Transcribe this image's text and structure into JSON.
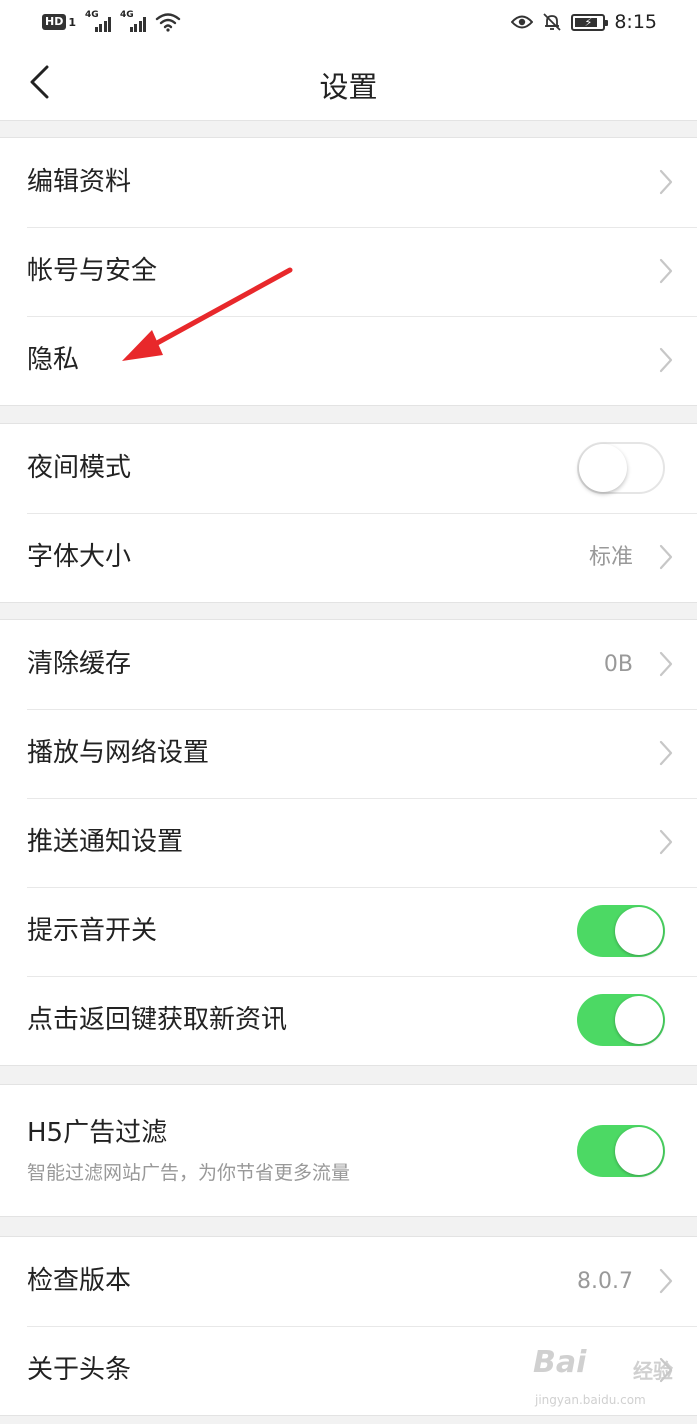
{
  "status_bar": {
    "hd_badge": "HD",
    "hd_sub": "1",
    "sim1_tag": "4G",
    "sim2_tag": "4G",
    "time": "8:15",
    "icons": [
      "signal-icon",
      "wifi-icon",
      "eye-icon",
      "mute-bell-icon",
      "battery-icon"
    ]
  },
  "nav": {
    "title": "设置",
    "back_icon": "chevron-left-icon"
  },
  "groups": {
    "account": {
      "edit_profile": "编辑资料",
      "account_security": "帐号与安全",
      "privacy": "隐私"
    },
    "display": {
      "night_mode": "夜间模式",
      "night_mode_on": false,
      "font_size": "字体大小",
      "font_size_value": "标准"
    },
    "general": {
      "clear_cache": "清除缓存",
      "cache_size": "0B",
      "playback_network": "播放与网络设置",
      "push_notifications": "推送通知设置",
      "alert_sound": "提示音开关",
      "alert_sound_on": true,
      "back_refresh": "点击返回键获取新资讯",
      "back_refresh_on": true
    },
    "ads": {
      "h5_filter": "H5广告过滤",
      "h5_filter_desc": "智能过滤网站广告，为你节省更多流量",
      "h5_filter_on": true
    },
    "about": {
      "check_version": "检查版本",
      "version": "8.0.7",
      "about_app": "关于头条"
    }
  },
  "watermark": {
    "logo": "Bai",
    "logo_cn": "经验",
    "url": "jingyan.baidu.com"
  },
  "colors": {
    "toggle_on": "#4cd964",
    "annotation_arrow": "#e8282b",
    "background": "#f2f2f2"
  }
}
